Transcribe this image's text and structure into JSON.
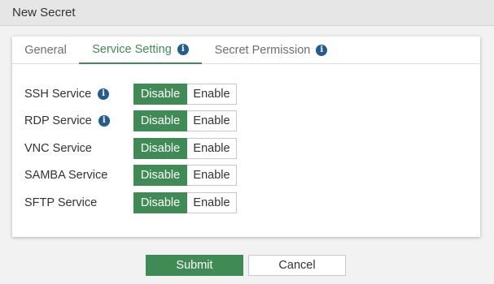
{
  "window": {
    "title": "New Secret"
  },
  "tabs": [
    {
      "label": "General",
      "active": false,
      "info_icon": false
    },
    {
      "label": "Service Setting",
      "active": true,
      "info_icon": true
    },
    {
      "label": "Secret Permission",
      "active": false,
      "info_icon": true
    }
  ],
  "services": [
    {
      "label": "SSH Service",
      "info_icon": true,
      "selected": "Disable"
    },
    {
      "label": "RDP Service",
      "info_icon": true,
      "selected": "Disable"
    },
    {
      "label": "VNC Service",
      "info_icon": false,
      "selected": "Disable"
    },
    {
      "label": "SAMBA Service",
      "info_icon": false,
      "selected": "Disable"
    },
    {
      "label": "SFTP Service",
      "info_icon": false,
      "selected": "Disable"
    }
  ],
  "toggle": {
    "disable_label": "Disable",
    "enable_label": "Enable"
  },
  "actions": {
    "submit_label": "Submit",
    "cancel_label": "Cancel"
  },
  "info_glyph": "i",
  "colors": {
    "accent": "#3f8a55",
    "info_icon": "#245c8f",
    "title_bar": "#e6e6e6",
    "page_background": "#f2f2f2"
  }
}
